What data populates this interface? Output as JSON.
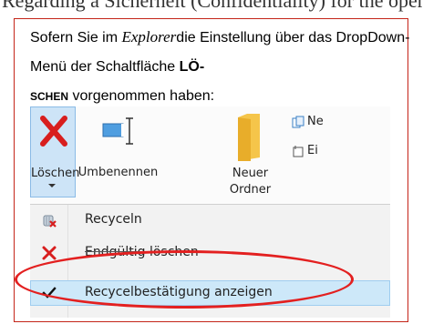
{
  "header_fragment": "Regarding a Sicherheit (Confidentiality) for the operation",
  "paragraph": {
    "before": "Sofern Sie im ",
    "explorer": "Explorer",
    "middle": "die Einstellung über das DropDown-Menü der Schaltfläche ",
    "bold1": "LÖ-",
    "bold2": "SCHEN",
    "after": " vorgenommen haben:"
  },
  "ribbon": {
    "loeschen_label": "Löschen",
    "umbenennen_label": "Umbenennen",
    "neuer_line1": "Neuer",
    "neuer_line2": "Ordner",
    "small_ne": "Ne",
    "small_ei": "Ei"
  },
  "menu": {
    "items": [
      {
        "label": "Recyceln",
        "icon": "recycle-bin-icon"
      },
      {
        "label": "Endgültig löschen",
        "icon": "red-x-icon"
      },
      {
        "label": "Recycelbestätigung anzeigen",
        "icon": "checkmark-icon",
        "checked": true
      }
    ]
  },
  "colors": {
    "frame_border": "#c42418",
    "highlight_ellipse": "#e32020",
    "selected_button": "#cde4f7",
    "checked_item": "#cde8f9",
    "delete_x": "#d81e1e"
  }
}
